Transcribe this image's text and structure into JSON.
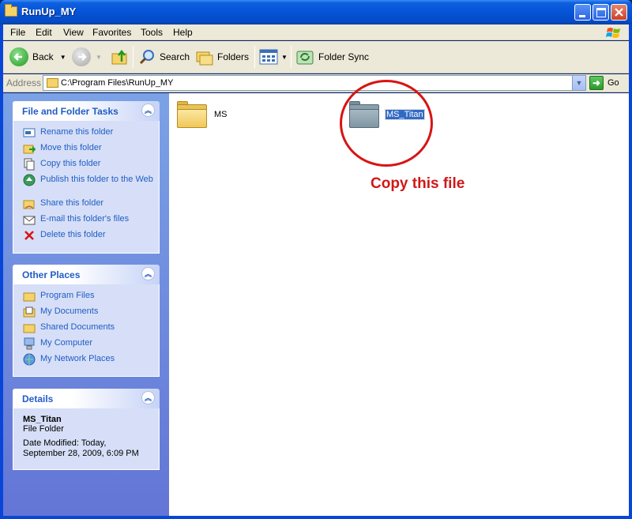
{
  "window": {
    "title": "RunUp_MY"
  },
  "menu": [
    "File",
    "Edit",
    "View",
    "Favorites",
    "Tools",
    "Help"
  ],
  "toolbar": {
    "back_label": "Back",
    "search_label": "Search",
    "folders_label": "Folders",
    "folder_sync_label": "Folder Sync"
  },
  "address": {
    "label": "Address",
    "path": "C:\\Program Files\\RunUp_MY",
    "go_label": "Go"
  },
  "tasks_panel": {
    "title": "File and Folder Tasks",
    "items": [
      {
        "label": "Rename this folder",
        "icon": "rename-icon"
      },
      {
        "label": "Move this folder",
        "icon": "move-icon"
      },
      {
        "label": "Copy this folder",
        "icon": "copy-icon"
      },
      {
        "label": "Publish this folder to the Web",
        "icon": "publish-icon"
      },
      {
        "label": "Share this folder",
        "icon": "share-icon"
      },
      {
        "label": "E-mail this folder's files",
        "icon": "email-icon"
      },
      {
        "label": "Delete this folder",
        "icon": "delete-icon"
      }
    ]
  },
  "places_panel": {
    "title": "Other Places",
    "items": [
      {
        "label": "Program Files",
        "icon": "folder-icon"
      },
      {
        "label": "My Documents",
        "icon": "my-documents-icon"
      },
      {
        "label": "Shared Documents",
        "icon": "folder-icon"
      },
      {
        "label": "My Computer",
        "icon": "my-computer-icon"
      },
      {
        "label": "My Network Places",
        "icon": "network-icon"
      }
    ]
  },
  "details_panel": {
    "title": "Details",
    "name": "MS_Titan",
    "type": "File Folder",
    "modified_line1": "Date Modified: Today,",
    "modified_line2": "September 28, 2009, 6:09 PM"
  },
  "files": [
    {
      "name": "MS",
      "selected": false
    },
    {
      "name": "MS_Titan",
      "selected": true
    }
  ],
  "annotation": {
    "text": "Copy this file",
    "color": "#d01818"
  },
  "colors": {
    "titlebar": "#0553d6",
    "link": "#215dc6",
    "selection": "#316ac5",
    "sidebar": "#7ba2e7"
  }
}
